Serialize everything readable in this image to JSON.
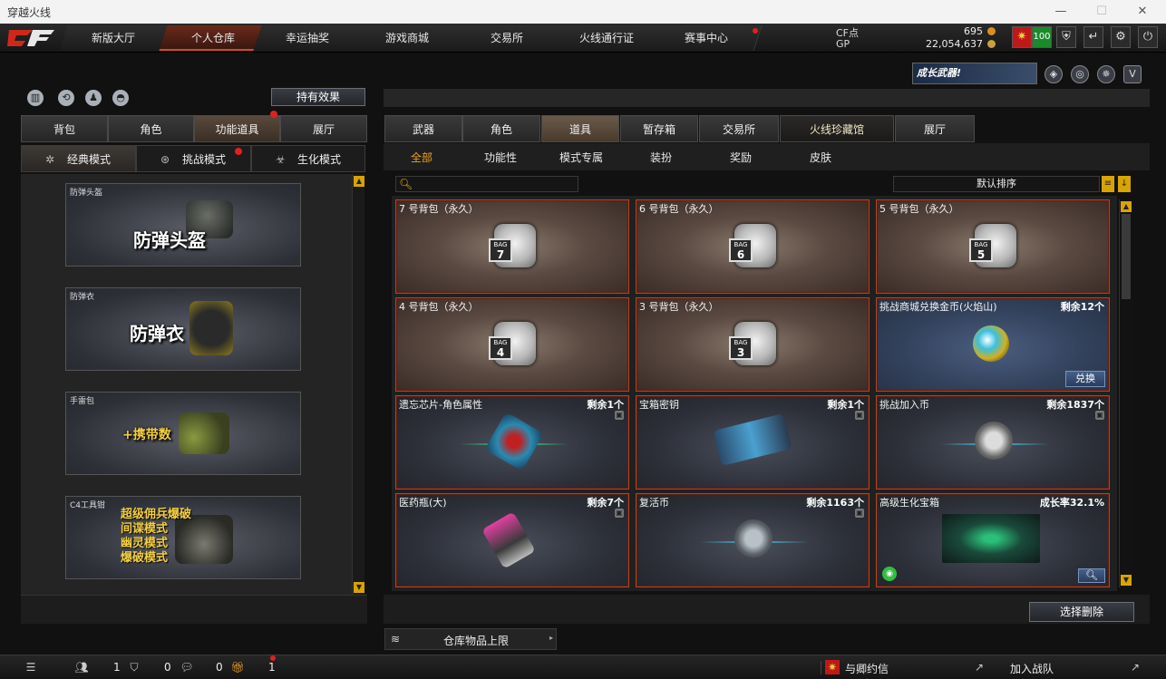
{
  "window": {
    "title": "穿越火线",
    "minimize": "—",
    "maximize": "☐",
    "close": "✕"
  },
  "topnav": {
    "logo": "CF",
    "tabs": [
      "新版大厅",
      "个人仓库",
      "幸运抽奖",
      "游戏商城",
      "交易所",
      "火线通行证",
      "赛事中心"
    ],
    "active_tab": 1,
    "currency": {
      "cf_label": "CF点",
      "cf_value": "695",
      "gp_label": "GP",
      "gp_value": "22,054,637"
    },
    "level_badge": "100"
  },
  "left": {
    "hold_effect_button": "持有效果",
    "tabs": [
      "背包",
      "角色",
      "功能道具",
      "展厅"
    ],
    "active_tab": 2,
    "modes": [
      "经典模式",
      "挑战模式",
      "生化模式"
    ],
    "active_mode": 0,
    "cards": [
      {
        "caption": "防弹头盔",
        "big": "防弹头盔"
      },
      {
        "caption": "防弹衣",
        "big": "防弹衣"
      },
      {
        "caption": "手雷包",
        "big": "+携带数"
      },
      {
        "caption": "C4工具钳",
        "lines": [
          "超级佣兵爆破",
          "间谍模式",
          "幽灵模式",
          "爆破模式"
        ]
      }
    ]
  },
  "right": {
    "banner": "成长武器!",
    "tabs": [
      "武器",
      "角色",
      "道具",
      "暂存箱",
      "交易所",
      "火线珍藏馆",
      "展厅"
    ],
    "active_tab": 2,
    "subtabs": [
      "全部",
      "功能性",
      "模式专属",
      "装扮",
      "奖励",
      "皮肤"
    ],
    "active_subtab": 0,
    "search_placeholder": "",
    "sort_label": "默认排序",
    "items": [
      {
        "name": "7 号背包（永久）",
        "kind": "bag",
        "bag_no": "7"
      },
      {
        "name": "6 号背包（永久）",
        "kind": "bag",
        "bag_no": "6"
      },
      {
        "name": "5 号背包（永久）",
        "kind": "bag",
        "bag_no": "5"
      },
      {
        "name": "4 号背包（永久）",
        "kind": "bag",
        "bag_no": "4"
      },
      {
        "name": "3 号背包（永久）",
        "kind": "bag",
        "bag_no": "3"
      },
      {
        "name": "挑战商城兑换金币(火焰山)",
        "remain": "剩余12个",
        "action": "兑换"
      },
      {
        "name": "遗忘芯片-角色属性",
        "remain": "剩余1个"
      },
      {
        "name": "宝箱密钥",
        "remain": "剩余1个"
      },
      {
        "name": "挑战加入币",
        "remain": "剩余1837个"
      },
      {
        "name": "医药瓶(大)",
        "remain": "剩余7个"
      },
      {
        "name": "复活币",
        "remain": "剩余1163个"
      },
      {
        "name": "高级生化宝箱",
        "remain": "成长率32.1%"
      }
    ],
    "bag_tag": "BAG",
    "delete_button": "选择删除",
    "capacity_button": "仓库物品上限"
  },
  "bottombar": {
    "count1": "1",
    "count2": "0",
    "count3": "0",
    "count4": "1",
    "friend_notice": "与卿约信",
    "join_team": "加入战队"
  }
}
